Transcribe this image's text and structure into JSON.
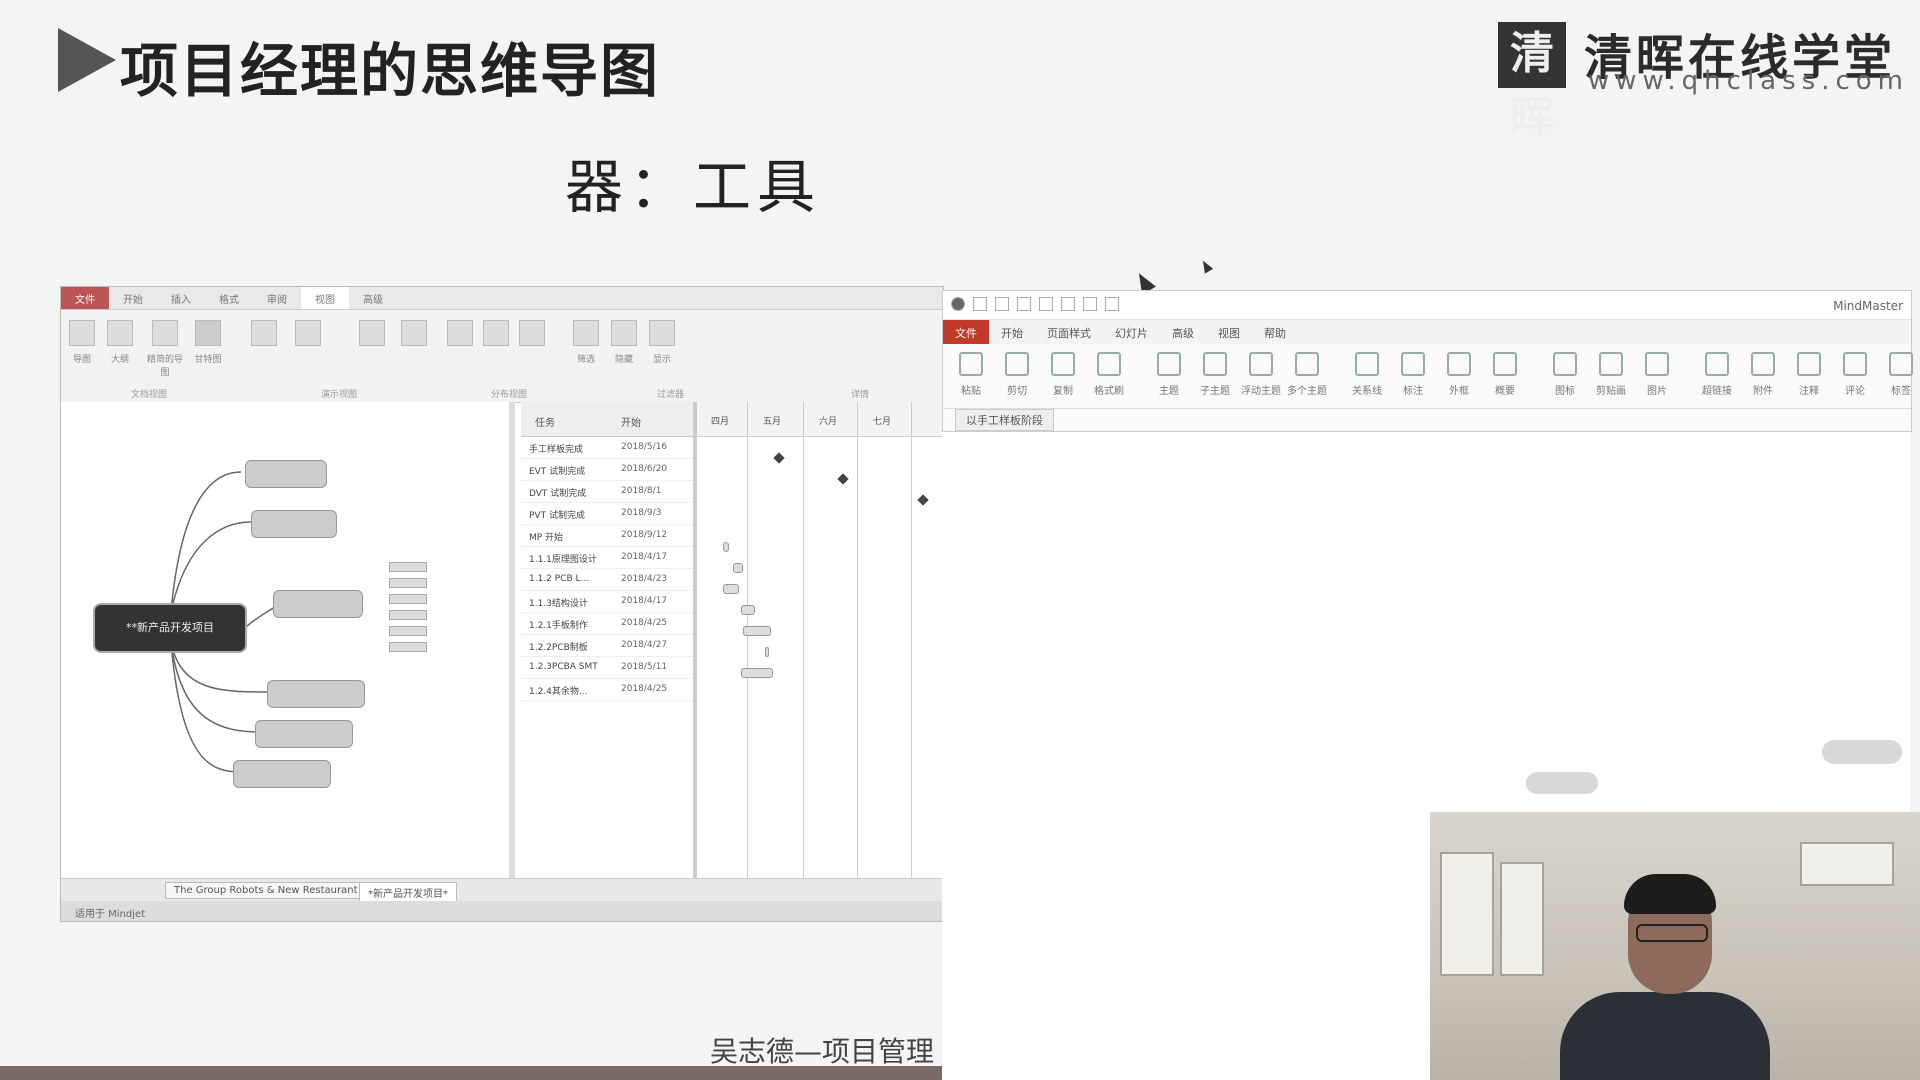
{
  "slide": {
    "title": "项目经理的思维导图",
    "subtitle": "器：工具",
    "caption": "吴志德—项目管理",
    "logo": {
      "mark": "清晖",
      "cn": "清晖在线学堂",
      "url": "www.qhclass.com"
    }
  },
  "mindmanager": {
    "menu": [
      "文件",
      "开始",
      "插入",
      "格式",
      "审阅",
      "视图",
      "高级"
    ],
    "active_menu": "视图",
    "ribbon_buttons": [
      "导图",
      "大纲",
      "精简的导图",
      "甘特图",
      "",
      "",
      "",
      "",
      "",
      "",
      "",
      "",
      "",
      "筛选",
      "隐藏",
      "显示"
    ],
    "ribbon_groups": [
      "文档视图",
      "演示视图",
      "分布视图",
      "过滤器",
      "详情"
    ],
    "central_topic": "**新产品开发项目",
    "gantt_headers": {
      "task": "任务",
      "start": "开始"
    },
    "gantt_months": [
      "四月",
      "五月",
      "六月",
      "七月"
    ],
    "gantt_rows": [
      {
        "name": "手工样板完成",
        "date": "2018/5/16"
      },
      {
        "name": "EVT 试制完成",
        "date": "2018/6/20"
      },
      {
        "name": "DVT 试制完成",
        "date": "2018/8/1"
      },
      {
        "name": "PVT 试制完成",
        "date": "2018/9/3"
      },
      {
        "name": "MP 开始",
        "date": "2018/9/12"
      },
      {
        "name": "1.1.1原理图设计",
        "date": "2018/4/17"
      },
      {
        "name": "1.1.2 PCB L...",
        "date": "2018/4/23"
      },
      {
        "name": "1.1.3结构设计",
        "date": "2018/4/17"
      },
      {
        "name": "1.2.1手板制作",
        "date": "2018/4/25"
      },
      {
        "name": "1.2.2PCB制板",
        "date": "2018/4/27"
      },
      {
        "name": "1.2.3PCBA SMT",
        "date": "2018/5/11"
      },
      {
        "name": "1.2.4其余物...",
        "date": "2018/4/25"
      }
    ],
    "doc_tabs": [
      "The Group Robots & New Restaurant",
      "*新产品开发项目*"
    ],
    "status": "适用于 Mindjet"
  },
  "mindmaster": {
    "app_name": "MindMaster",
    "menu": [
      "文件",
      "开始",
      "页面样式",
      "幻灯片",
      "高级",
      "视图",
      "帮助"
    ],
    "ribbon_buttons": [
      "粘贴",
      "剪切",
      "复制",
      "格式刷",
      "主题",
      "子主题",
      "浮动主题",
      "多个主题",
      "关系线",
      "标注",
      "外框",
      "概要",
      "图标",
      "剪贴画",
      "图片",
      "超链接",
      "附件",
      "注释",
      "评论",
      "标签"
    ],
    "doc_tab": "以手工样板阶段"
  }
}
